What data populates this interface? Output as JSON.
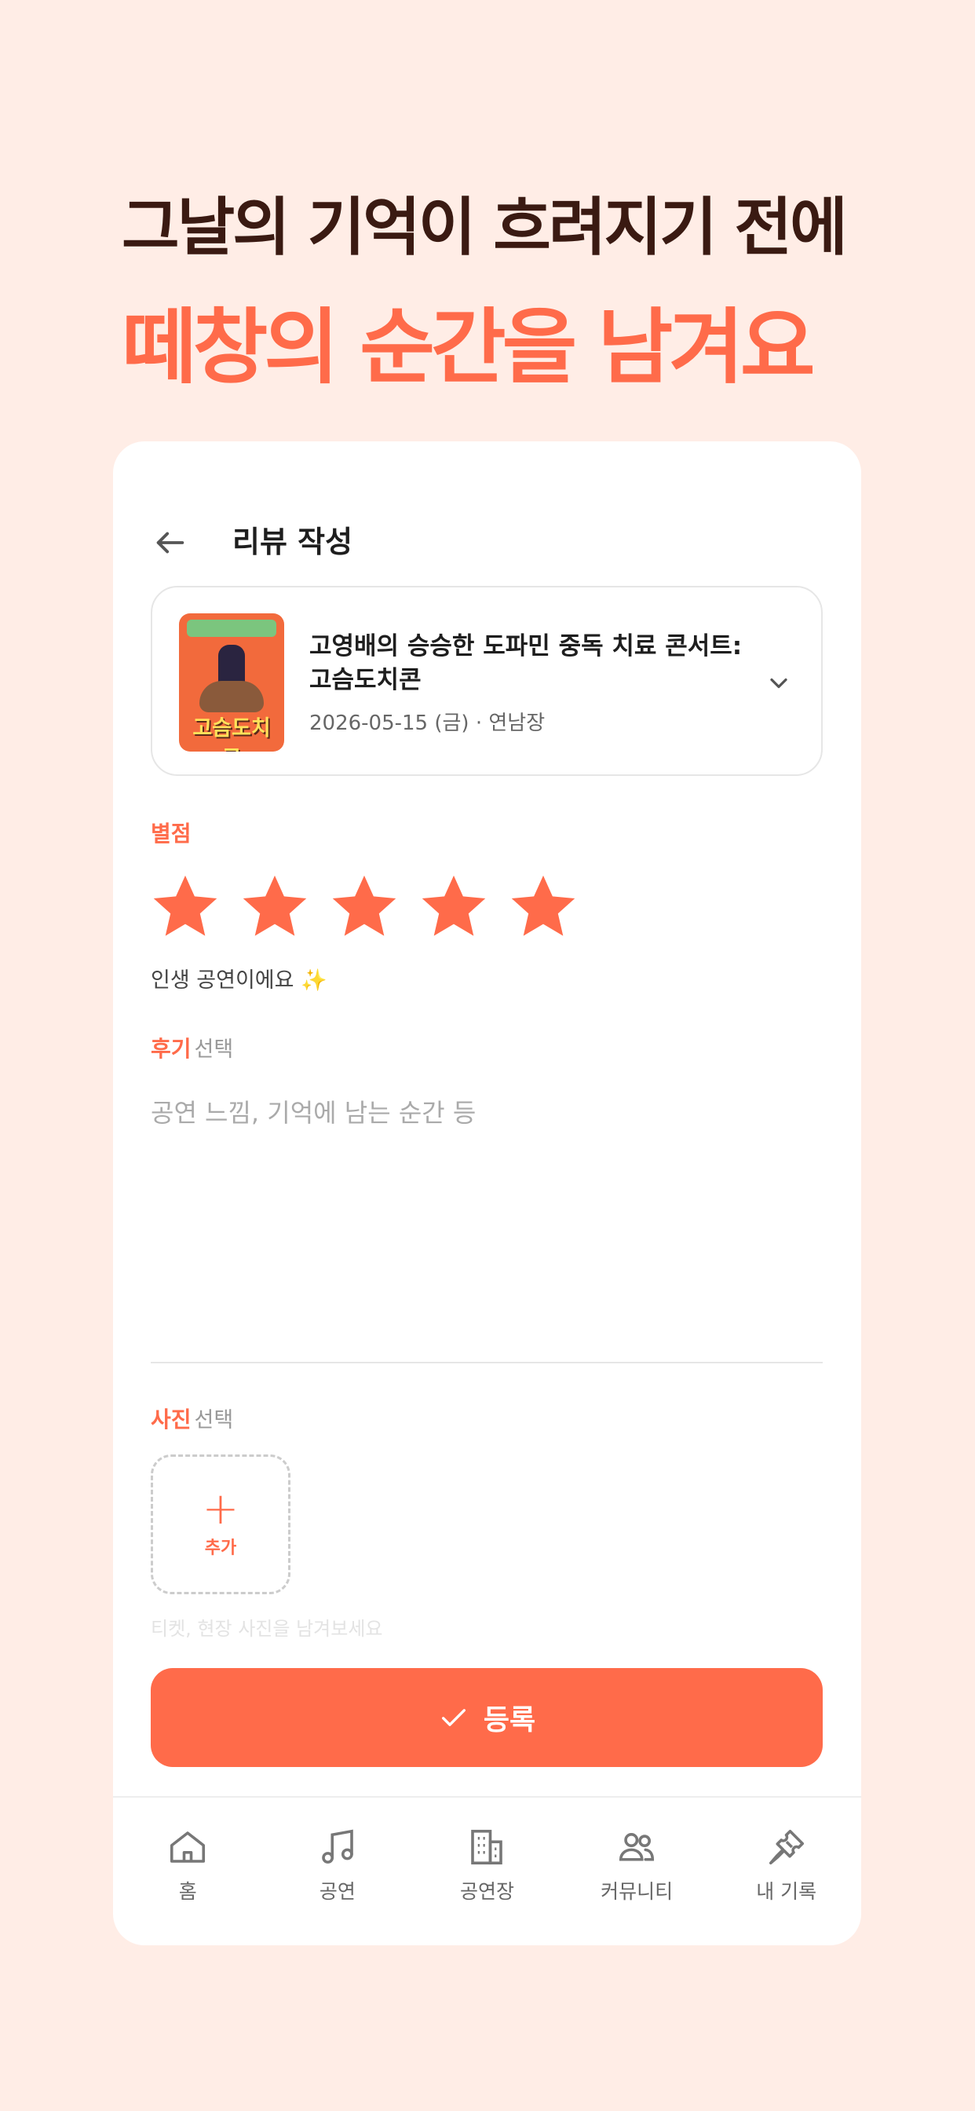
{
  "headline": {
    "line1": "그날의 기억이 흐려지기 전에",
    "line2": "떼창의 순간을 남겨요"
  },
  "screen": {
    "title": "리뷰 작성",
    "back_icon": "arrow-left-icon"
  },
  "performance": {
    "title": "고영배의 승승한 도파민 중독 치료 콘서트: 고슴도치콘",
    "meta": "2026-05-15 (금) · 연남장",
    "poster_text": "고슴도치콘",
    "expand_icon": "chevron-down-icon"
  },
  "rating": {
    "label": "별점",
    "value": 5,
    "max": 5,
    "text": "인생 공연이에요 ✨"
  },
  "review": {
    "label": "후기",
    "optional": "선택",
    "placeholder": "공연 느낌, 기억에 남는 순간 등",
    "value": ""
  },
  "photo": {
    "label": "사진",
    "optional": "선택",
    "add_label": "추가",
    "hint": "티켓, 현장 사진을 남겨보세요"
  },
  "submit": {
    "label": "등록",
    "icon": "check-icon"
  },
  "tabbar": {
    "items": [
      {
        "label": "홈",
        "icon": "home-icon"
      },
      {
        "label": "공연",
        "icon": "music-note-icon"
      },
      {
        "label": "공연장",
        "icon": "building-icon"
      },
      {
        "label": "커뮤니티",
        "icon": "users-icon"
      },
      {
        "label": "내 기록",
        "icon": "ticket-icon"
      }
    ]
  },
  "colors": {
    "background": "#FFEDE6",
    "accent": "#FF6B4A",
    "headline_dark": "#3A1A12"
  }
}
